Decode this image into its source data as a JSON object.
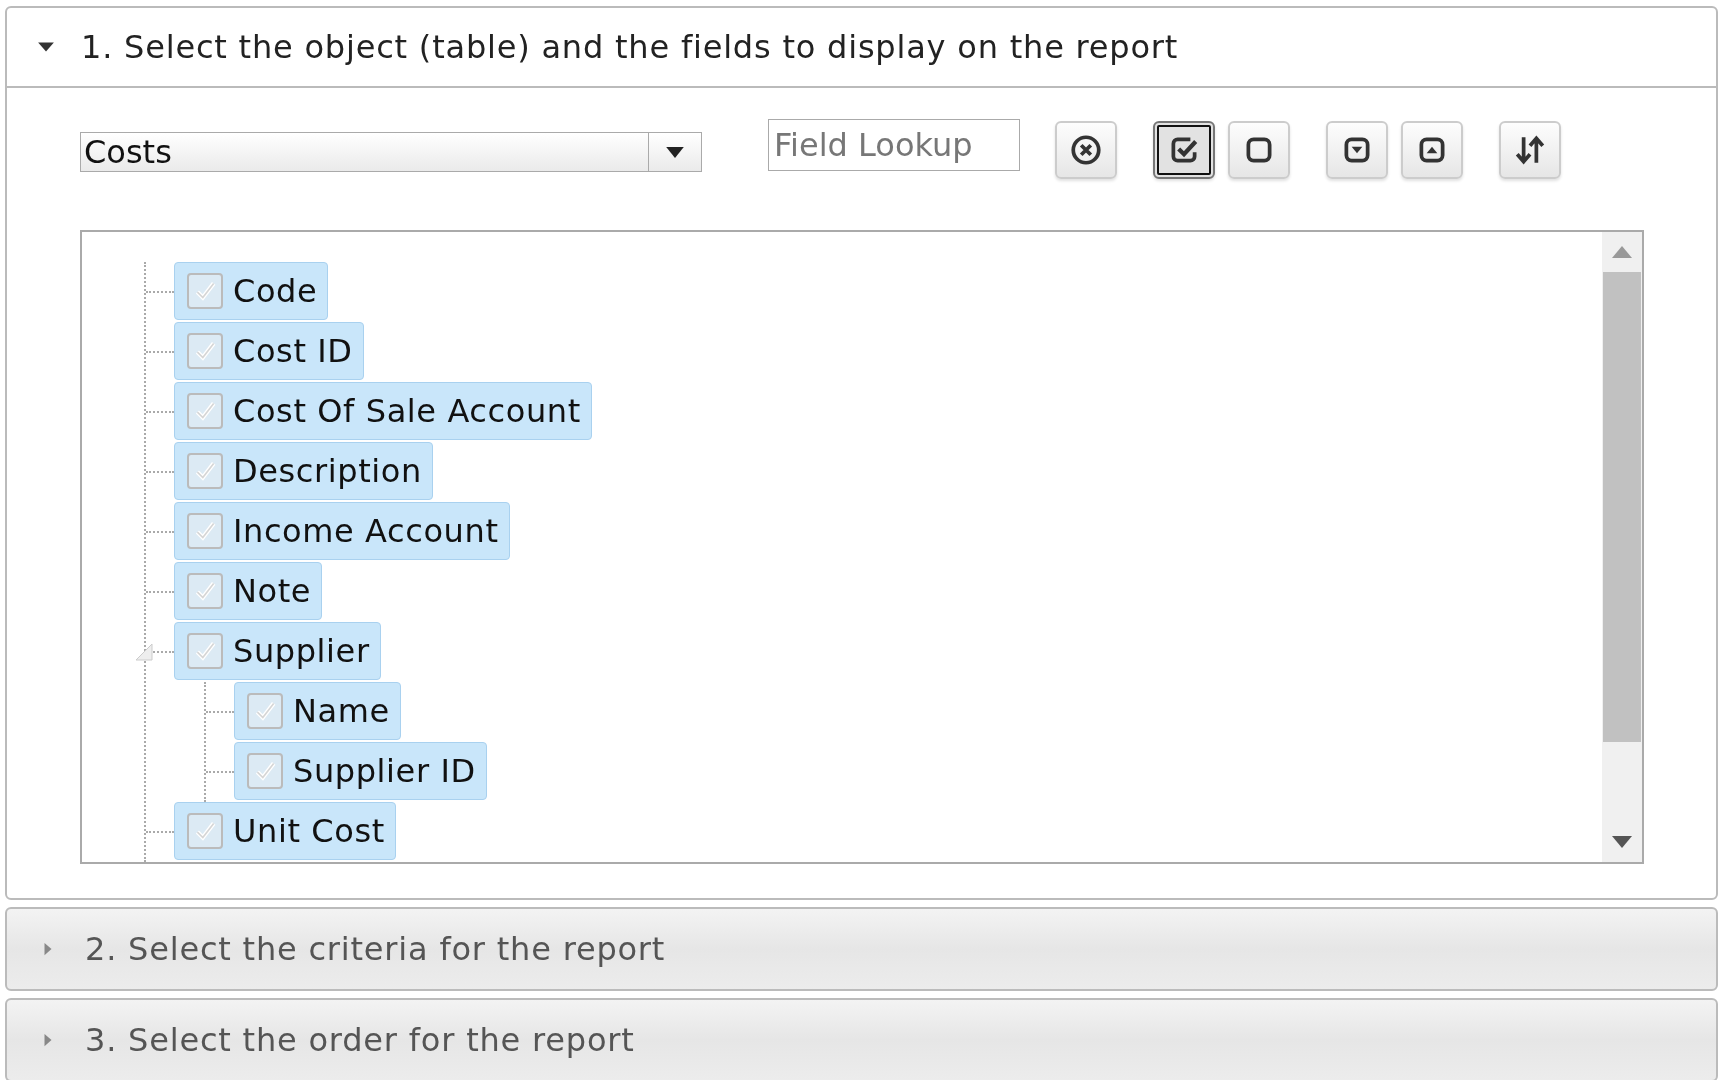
{
  "sections": [
    {
      "title": "1. Select the object (table) and the fields to display on the report",
      "expanded": true
    },
    {
      "title": "2. Select the criteria for the report",
      "expanded": false
    },
    {
      "title": "3. Select the order for the report",
      "expanded": false
    }
  ],
  "object_select": {
    "value": "Costs"
  },
  "field_lookup": {
    "placeholder": "Field Lookup"
  },
  "toolbar": [
    {
      "kind": "clear",
      "selected": false
    },
    {
      "kind": "check-all",
      "selected": true
    },
    {
      "kind": "uncheck-all",
      "selected": false
    },
    {
      "kind": "expand-all",
      "selected": false
    },
    {
      "kind": "collapse-all",
      "selected": false
    },
    {
      "kind": "sort",
      "selected": false
    }
  ],
  "tree": [
    {
      "label": "Code",
      "checked": true
    },
    {
      "label": "Cost ID",
      "checked": true
    },
    {
      "label": "Cost Of Sale Account",
      "checked": true
    },
    {
      "label": "Description",
      "checked": true
    },
    {
      "label": "Income Account",
      "checked": true
    },
    {
      "label": "Note",
      "checked": true
    },
    {
      "label": "Supplier",
      "checked": true,
      "expanded": true,
      "children": [
        {
          "label": "Name",
          "checked": true
        },
        {
          "label": "Supplier ID",
          "checked": true
        }
      ]
    },
    {
      "label": "Unit Cost",
      "checked": true
    }
  ]
}
